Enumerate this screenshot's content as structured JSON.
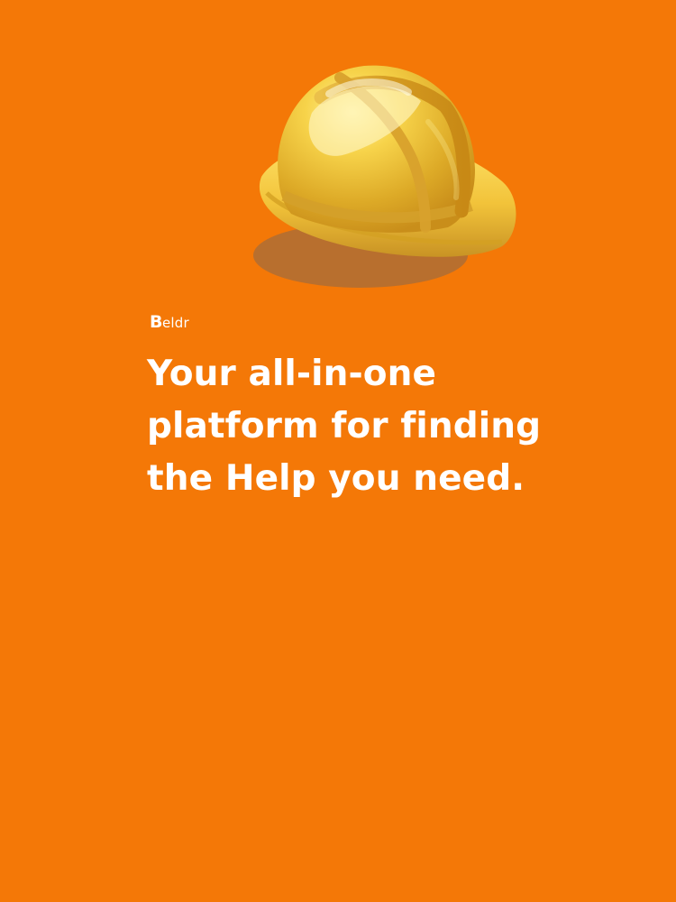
{
  "brand": {
    "initial": "B",
    "rest": "eldr"
  },
  "headline": {
    "line1": "Your all-in-one",
    "line2": "platform for finding",
    "line3": "the Help you need."
  },
  "colors": {
    "background": "#F47807",
    "text": "#FFFFFF",
    "helmet": "#F2C33A"
  },
  "illustration": {
    "icon": "hard-hat-icon"
  }
}
